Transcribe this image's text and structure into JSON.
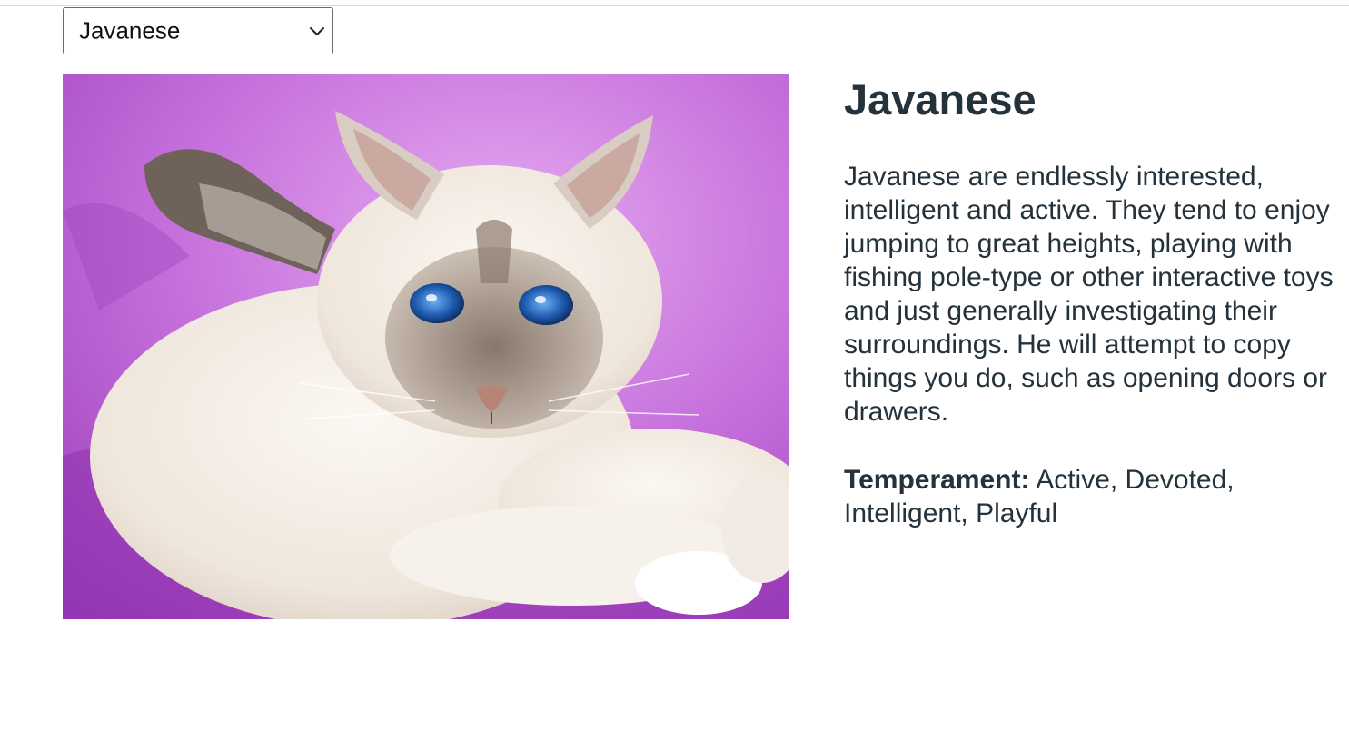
{
  "selector": {
    "selected": "Javanese",
    "chevron_icon": "chevron-down-icon"
  },
  "breed": {
    "name": "Javanese",
    "photo_subject": "cat-photo",
    "description": "Javanese are endlessly interested, intelligent and active. They tend to enjoy jumping to great heights, playing with fishing pole-type or other interactive toys and just generally investigating their surroundings. He will attempt to copy things you do, such as opening doors or drawers.",
    "temperament_label": "Temperament:",
    "temperament_value": "Active, Devoted, Intelligent, Playful"
  },
  "colors": {
    "text": "#24323b",
    "background_purple": "#b75fd0"
  }
}
